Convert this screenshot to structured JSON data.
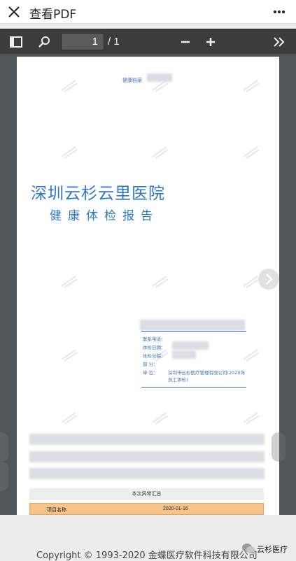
{
  "appbar": {
    "title": "查看PDF",
    "close_icon": "close-icon",
    "more_icon": "more-vertical-icon"
  },
  "toolbar": {
    "sidebar_icon": "sidebar-toggle-icon",
    "search_icon": "search-icon",
    "page_current": "1",
    "page_total": "/ 1",
    "zoom_out_icon": "minus-icon",
    "zoom_in_icon": "plus-icon",
    "more_tools_icon": "double-chevron-right-icon"
  },
  "document": {
    "dossier_label": "健康档案",
    "hospital_name": "深圳云杉云里医院",
    "report_title": "健康体检报告",
    "info": {
      "phone_label": "联系电话：",
      "date_label": "体检日期：",
      "branch_label": "体检分院：",
      "dept_label": "部      分：",
      "unit_label": "单      位：",
      "unit_value_line1": "深圳市云杉医疗管理有限公司(2020年",
      "unit_value_line2": "员工体检)"
    },
    "summary_label": "本次异常汇总",
    "table_header": {
      "item_label": "项目名称",
      "date_value": "2020-01-16"
    }
  },
  "footer": {
    "copyright": "Copyright © 1993-2020 金蝶医疗软件科技有限公司",
    "brand": "云杉医疗"
  },
  "colors": {
    "hospital_blue": "#2e78c8",
    "toolbar_bg": "#3c3c3c",
    "viewer_bg": "#525659",
    "table_header_bg": "#f6c48a"
  }
}
